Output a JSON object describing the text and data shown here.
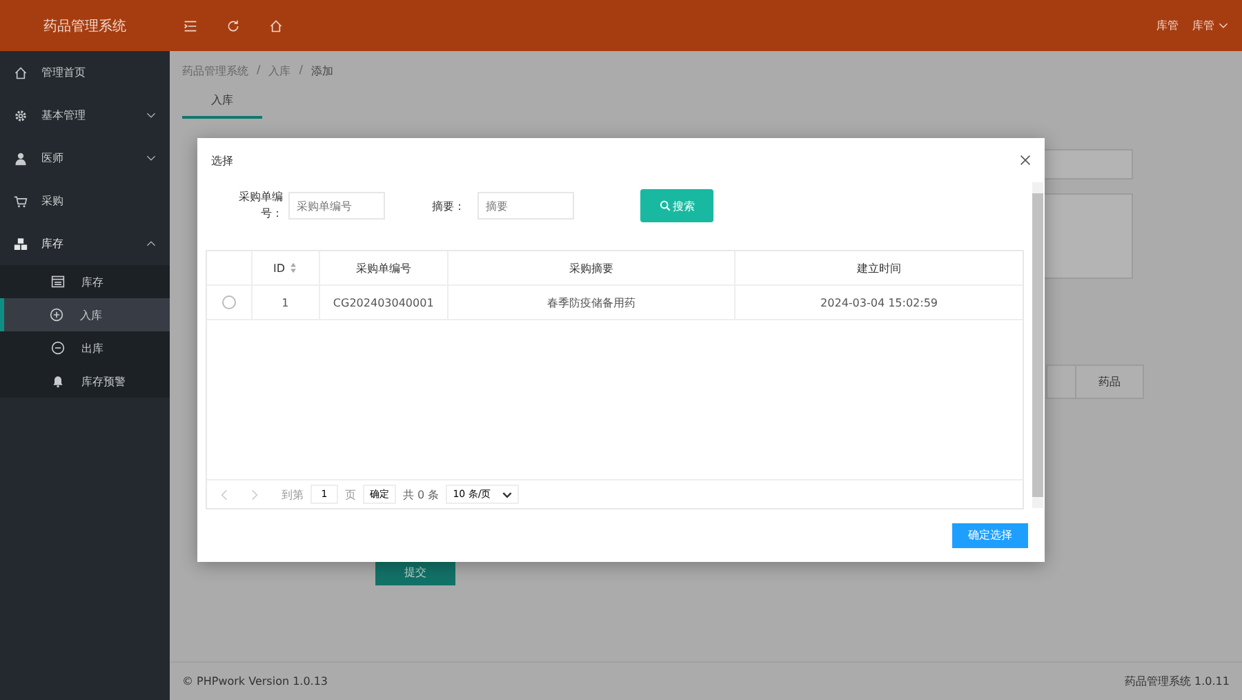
{
  "app_title": "药品管理系统",
  "header_user_items": [
    {
      "label": "库管",
      "dropdown": false
    },
    {
      "label": "库管",
      "dropdown": true
    }
  ],
  "sidebar": {
    "items": [
      {
        "label": "管理首页"
      },
      {
        "label": "基本管理",
        "expanded": false
      },
      {
        "label": "医师",
        "expanded": false
      },
      {
        "label": "采购"
      },
      {
        "label": "库存",
        "expanded": true,
        "children": [
          {
            "label": "库存",
            "selected": false
          },
          {
            "label": "入库",
            "selected": true
          },
          {
            "label": "出库",
            "selected": false
          },
          {
            "label": "库存预警",
            "selected": false
          }
        ]
      }
    ]
  },
  "breadcrumb": [
    {
      "text": "药品管理系统"
    },
    {
      "separator": "/",
      "text": "入库"
    },
    {
      "separator": "/",
      "text": "添加"
    }
  ],
  "page_tab": "入库",
  "background_table_header": "药品",
  "submit_button": "提交",
  "modal": {
    "title": "选择",
    "filters": [
      {
        "label": "采购单编号：",
        "placeholder": "采购单编号"
      },
      {
        "label": "摘要：",
        "placeholder": "摘要"
      }
    ],
    "search_button": "搜索",
    "table": {
      "columns": [
        {
          "label": "ID",
          "sortable": true
        },
        {
          "label": "采购单编号",
          "sortable": false
        },
        {
          "label": "采购摘要",
          "sortable": false
        },
        {
          "label": "建立时间",
          "sortable": false
        }
      ],
      "rows": [
        {
          "selected": false,
          "cells": [
            "1",
            "CG202403040001",
            "春季防疫储备用药",
            "2024-03-04 15:02:59"
          ]
        }
      ]
    },
    "pagination": {
      "goto_label": "到第",
      "page": "1",
      "page_unit": "页",
      "go_button": "确定",
      "total": "共 0 条",
      "page_size": "10 条/页"
    },
    "confirm_button": "确定选择"
  },
  "footer": {
    "left": "© PHPwork Version 1.0.13",
    "right": "药品管理系统 1.0.11"
  }
}
